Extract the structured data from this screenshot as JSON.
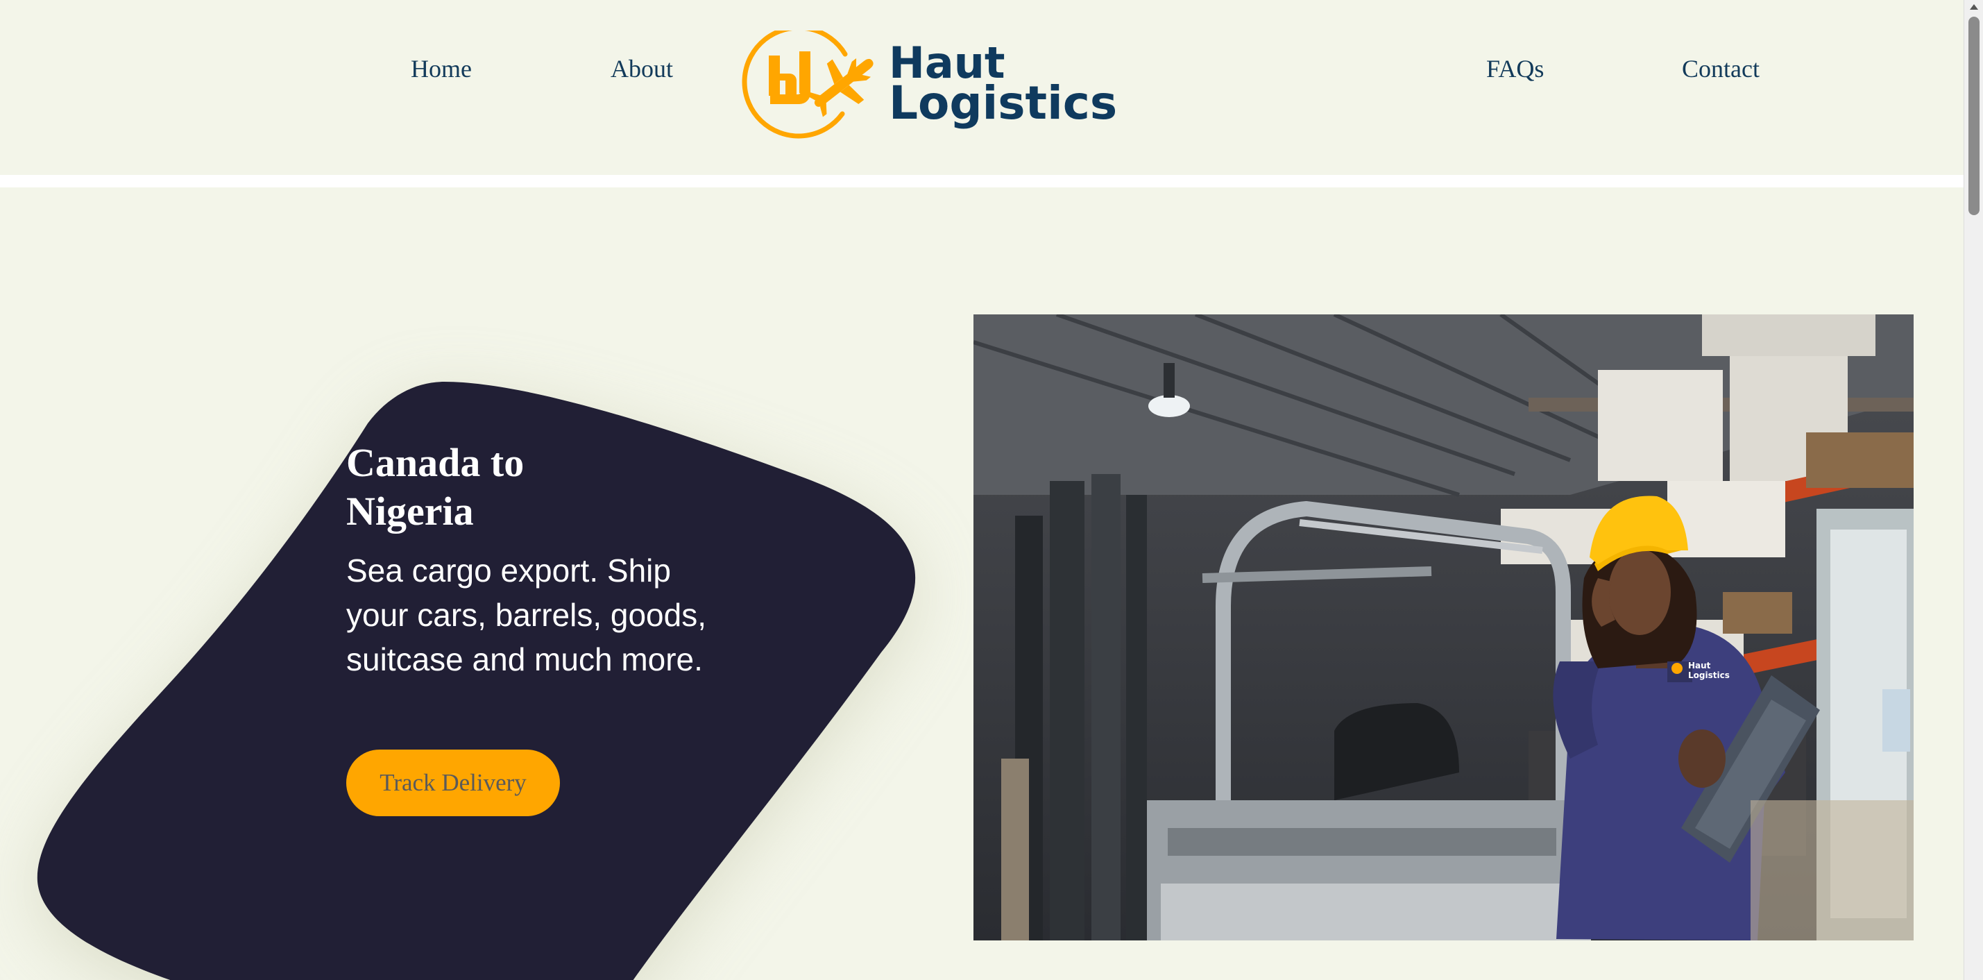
{
  "nav": {
    "home": "Home",
    "about": "About",
    "faqs": "FAQs",
    "contact": "Contact"
  },
  "logo": {
    "line1": "Haut",
    "line2": "Logistics",
    "badge_line1": "Haut",
    "badge_line2": "Logistics"
  },
  "hero": {
    "title": "Canada to Nigeria",
    "description": "Sea cargo export. Ship your cars, barrels, goods, suitcase and much more.",
    "button": "Track Delivery"
  },
  "colors": {
    "background": "#f3f5e9",
    "navy": "#0f3a5e",
    "blob": "#211f35",
    "accent": "#ffa600"
  },
  "icons": {
    "logo_mark": "hj-airplane-logo-icon"
  }
}
